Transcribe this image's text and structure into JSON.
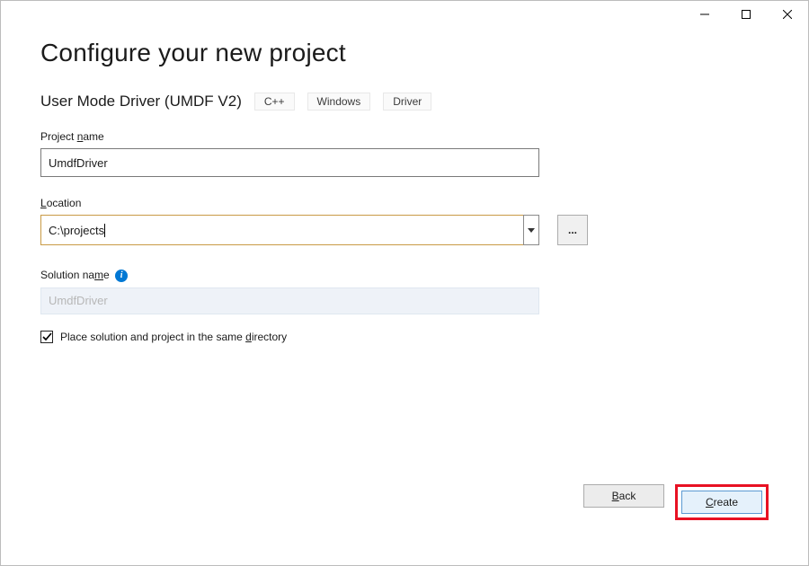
{
  "titlebar": {
    "minimize_title": "Minimize",
    "maximize_title": "Maximize",
    "close_title": "Close"
  },
  "page": {
    "title": "Configure your new project",
    "template_name": "User Mode Driver (UMDF V2)",
    "tags": [
      "C++",
      "Windows",
      "Driver"
    ]
  },
  "fields": {
    "project_name": {
      "label_pre": "Project ",
      "label_u": "n",
      "label_post": "ame",
      "value": "UmdfDriver"
    },
    "location": {
      "label_u": "L",
      "label_post": "ocation",
      "value": "C:\\projects",
      "browse_label": "..."
    },
    "solution_name": {
      "label_pre": "Solution na",
      "label_u": "m",
      "label_post": "e",
      "info_glyph": "i",
      "placeholder": "UmdfDriver"
    },
    "same_dir": {
      "checked": true,
      "label_pre": "Place solution and project in the same ",
      "label_u": "d",
      "label_post": "irectory"
    }
  },
  "buttons": {
    "back_u": "B",
    "back_post": "ack",
    "create_u": "C",
    "create_post": "reate"
  }
}
